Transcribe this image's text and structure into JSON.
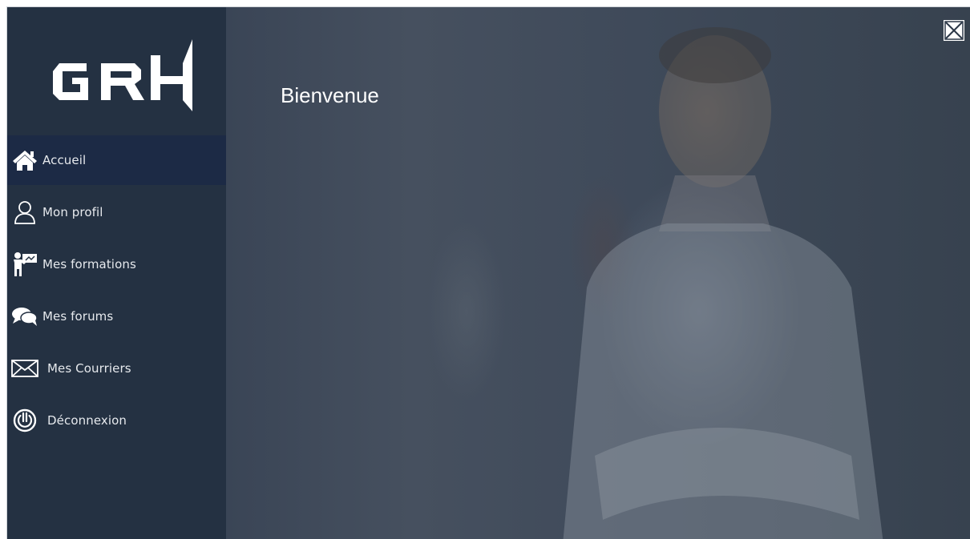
{
  "app": {
    "logo_text": "GRH",
    "welcome": "Bienvenue"
  },
  "sidebar": {
    "items": [
      {
        "label": "Accueil",
        "icon": "home-icon",
        "active": true
      },
      {
        "label": "Mon profil",
        "icon": "user-icon",
        "active": false
      },
      {
        "label": "Mes formations",
        "icon": "trainer-icon",
        "active": false
      },
      {
        "label": "Mes forums",
        "icon": "chat-icon",
        "active": false
      },
      {
        "label": "Mes Courriers",
        "icon": "mail-icon",
        "active": false
      },
      {
        "label": "Déconnexion",
        "icon": "power-icon",
        "active": false
      }
    ]
  },
  "window": {
    "close_icon": "close-icon"
  },
  "colors": {
    "sidebar_bg": "#243142",
    "active_item_bg": "#1c2a45",
    "text": "#ffffff"
  }
}
